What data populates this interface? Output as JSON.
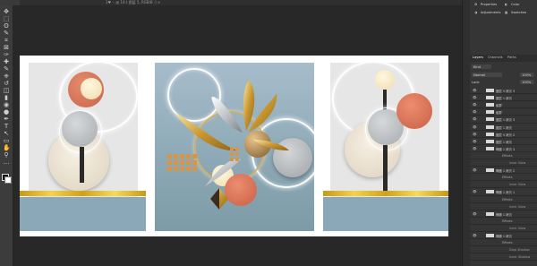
{
  "document": {
    "tab_title": "1♥ ·· @ 14·( 图层 5,    RGB/8 ·)   ×"
  },
  "toolbar": {
    "tools": [
      "move-icon",
      "marquee-icon",
      "lasso-icon",
      "quick-select-icon",
      "crop-icon",
      "frame-icon",
      "eyedropper-icon",
      "healing-icon",
      "brush-icon",
      "stamp-icon",
      "history-brush-icon",
      "eraser-icon",
      "gradient-icon",
      "blur-icon",
      "dodge-icon",
      "pen-icon",
      "type-icon",
      "path-select-icon",
      "shape-icon",
      "hand-icon",
      "zoom-icon",
      "more-icon"
    ],
    "glyphs": [
      "✥",
      "⬚",
      "ʘ",
      "✎",
      "⌗",
      "⊠",
      "✑",
      "✚",
      "✎",
      "⎈",
      "↺",
      "◫",
      "▮",
      "◉",
      "●",
      "✒",
      "T",
      "↖",
      "▭",
      "✋",
      "⚲",
      "…"
    ]
  },
  "right": {
    "properties": "Properties",
    "adjustments": "Adjustments",
    "color": "Color",
    "swatches": "Swatches",
    "tabs": [
      "Layers",
      "Channels",
      "Paths"
    ],
    "kind": "Kind",
    "blend": "Normal",
    "opacity": "100%",
    "lock": "Lock:",
    "fill": "100%"
  },
  "layers": [
    {
      "name": "图层 5 拷贝 3",
      "type": "layer"
    },
    {
      "name": "图层 1 拷贝",
      "type": "layer"
    },
    {
      "name": "组群",
      "type": "layer"
    },
    {
      "name": "组群",
      "type": "layer"
    },
    {
      "name": "图层 1 拷贝 3",
      "type": "layer"
    },
    {
      "name": "图层 1 拷贝",
      "type": "layer"
    },
    {
      "name": "图层 5 拷贝 2",
      "type": "layer"
    },
    {
      "name": "图层 1 拷贝",
      "type": "layer"
    },
    {
      "name": "椭圆 1 拷贝 3",
      "type": "layer"
    },
    {
      "name": "Effects",
      "type": "fx"
    },
    {
      "name": "Inner Glow",
      "type": "sub"
    },
    {
      "name": "椭圆 1 拷贝 2",
      "type": "layer"
    },
    {
      "name": "Effects",
      "type": "fx"
    },
    {
      "name": "Inner Glow",
      "type": "sub"
    },
    {
      "name": "椭圆 1 拷贝 1",
      "type": "layer"
    },
    {
      "name": "Effects",
      "type": "fx"
    },
    {
      "name": "Inner Glow",
      "type": "sub"
    },
    {
      "name": "椭圆 1 拷贝",
      "type": "layer"
    },
    {
      "name": "Effects",
      "type": "fx"
    },
    {
      "name": "Inner Glow",
      "type": "sub"
    },
    {
      "name": "椭圆 1 拷贝",
      "type": "layer"
    },
    {
      "name": "Effects",
      "type": "fx"
    },
    {
      "name": "Drop Shadow",
      "type": "sub"
    },
    {
      "name": "Inner Shadow",
      "type": "sub"
    }
  ],
  "colors": {
    "terracotta": "#d9775c",
    "cream": "#f1e3c0",
    "slate": "#8aa8b8",
    "gold": "#e6bf3a"
  }
}
